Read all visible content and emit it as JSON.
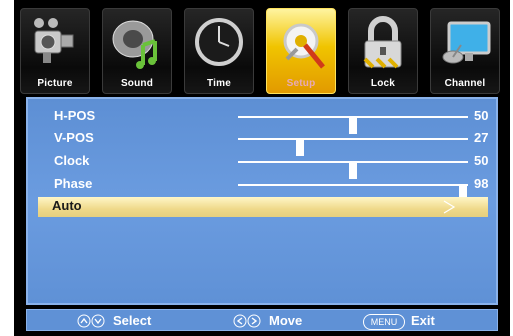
{
  "tabs": [
    {
      "label": "Picture",
      "icon": "camera-icon"
    },
    {
      "label": "Sound",
      "icon": "speaker-icon"
    },
    {
      "label": "Time",
      "icon": "clock-icon"
    },
    {
      "label": "Setup",
      "icon": "gear-icon",
      "active": true
    },
    {
      "label": "Lock",
      "icon": "padlock-icon"
    },
    {
      "label": "Channel",
      "icon": "monitor-icon"
    }
  ],
  "settings": [
    {
      "label": "H-POS",
      "value": "50",
      "level": 0.5
    },
    {
      "label": "V-POS",
      "value": "27",
      "level": 0.27
    },
    {
      "label": "Clock",
      "value": "50",
      "level": 0.5
    },
    {
      "label": "Phase",
      "value": "98",
      "level": 0.98
    }
  ],
  "auto": {
    "label": "Auto",
    "icon": "arrow-right-icon"
  },
  "help": {
    "select": "Select",
    "move": "Move",
    "menu_key": "MENU",
    "exit": "Exit"
  },
  "colors": {
    "panel": "#6b9ce0",
    "highlight": "#efd98a",
    "active_tab": "#f0c400"
  }
}
